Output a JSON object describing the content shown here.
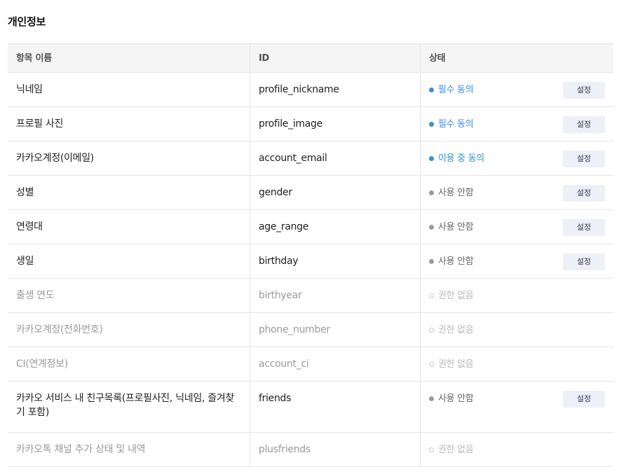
{
  "section_title": "개인정보",
  "table": {
    "headers": [
      "항목 이름",
      "ID",
      "상태"
    ],
    "setting_label": "설정",
    "rows": [
      {
        "name": "닉네임",
        "id": "profile_nickname",
        "status": "필수 동의",
        "status_type": "blue",
        "has_setting": true
      },
      {
        "name": "프로필 사진",
        "id": "profile_image",
        "status": "필수 동의",
        "status_type": "blue",
        "has_setting": true
      },
      {
        "name": "카카오계정(이메일)",
        "id": "account_email",
        "status": "이용 중 동의",
        "status_type": "teal",
        "has_setting": true
      },
      {
        "name": "성별",
        "id": "gender",
        "status": "사용 안함",
        "status_type": "gray",
        "has_setting": true
      },
      {
        "name": "연령대",
        "id": "age_range",
        "status": "사용 안함",
        "status_type": "gray",
        "has_setting": true
      },
      {
        "name": "생일",
        "id": "birthday",
        "status": "사용 안함",
        "status_type": "gray",
        "has_setting": true
      },
      {
        "name": "출생 연도",
        "id": "birthyear",
        "status": "권한 없음",
        "status_type": "none",
        "has_setting": false
      },
      {
        "name": "카카오계정(전화번호)",
        "id": "phone_number",
        "status": "권한 없음",
        "status_type": "none",
        "has_setting": false
      },
      {
        "name": "CI(연계정보)",
        "id": "account_ci",
        "status": "권한 없음",
        "status_type": "none",
        "has_setting": false
      },
      {
        "name": "카카오 서비스 내 친구목록(프로필사진, 닉네임, 즐겨찾기 포함)",
        "id": "friends",
        "status": "사용 안함",
        "status_type": "gray",
        "has_setting": true
      },
      {
        "name": "카카오톡 채널 추가 상태 및 내역",
        "id": "plusfriends",
        "status": "권한 없음",
        "status_type": "none",
        "has_setting": false
      }
    ]
  },
  "colors": {
    "required": "#3a8ee6",
    "in_use": "#3194c4",
    "unused": "#9a9a9a",
    "no_permission": "#c8c8c8"
  }
}
